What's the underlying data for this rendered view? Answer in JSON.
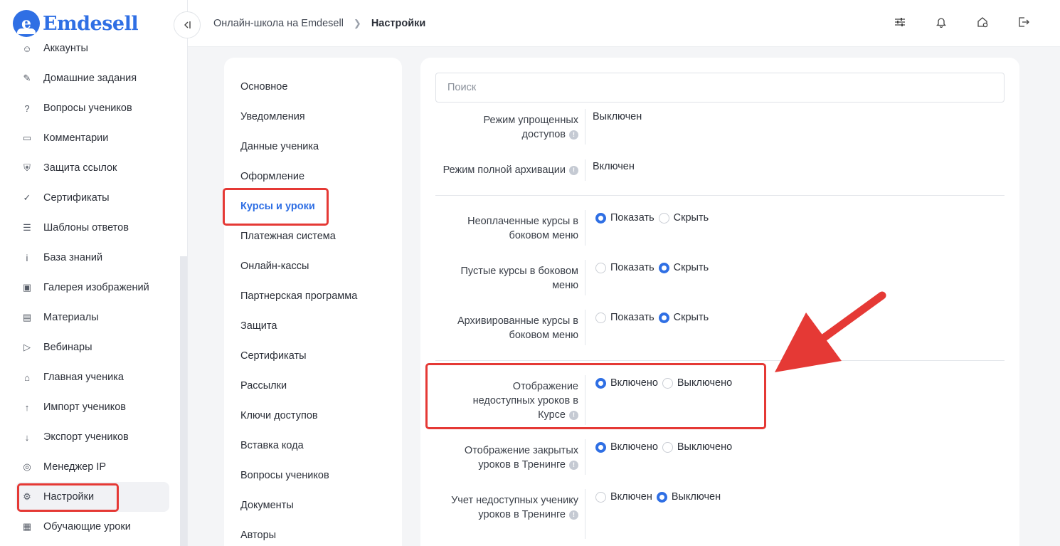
{
  "app": {
    "logo_letter": "e",
    "logo_text": "Emdesell",
    "brand_color": "#2f6fe4",
    "annotation_color": "#e53935"
  },
  "sidebar": {
    "items": [
      {
        "label": "Аккаунты",
        "icon": "users-icon"
      },
      {
        "label": "Домашние задания",
        "icon": "pencil-icon"
      },
      {
        "label": "Вопросы учеников",
        "icon": "question-circle-icon"
      },
      {
        "label": "Комментарии",
        "icon": "comment-icon"
      },
      {
        "label": "Защита ссылок",
        "icon": "shield-icon"
      },
      {
        "label": "Сертификаты",
        "icon": "badge-icon"
      },
      {
        "label": "Шаблоны ответов",
        "icon": "list-icon"
      },
      {
        "label": "База знаний",
        "icon": "info-circle-icon"
      },
      {
        "label": "Галерея изображений",
        "icon": "image-icon"
      },
      {
        "label": "Материалы",
        "icon": "briefcase-icon"
      },
      {
        "label": "Вебинары",
        "icon": "play-icon"
      },
      {
        "label": "Главная ученика",
        "icon": "home-icon"
      },
      {
        "label": "Импорт учеников",
        "icon": "upload-icon"
      },
      {
        "label": "Экспорт учеников",
        "icon": "download-icon"
      },
      {
        "label": "Менеджер IP",
        "icon": "target-icon"
      },
      {
        "label": "Настройки",
        "icon": "gear-icon",
        "active": true
      },
      {
        "label": "Обучающие уроки",
        "icon": "film-icon"
      }
    ]
  },
  "header": {
    "breadcrumb": [
      "Онлайн-школа на Emdesell",
      "Настройки"
    ],
    "icons": [
      "sliders-icon",
      "bell-icon",
      "home-settings-icon",
      "logout-icon"
    ]
  },
  "settings_menu": {
    "items": [
      "Основное",
      "Уведомления",
      "Данные ученика",
      "Оформление",
      "Курсы и уроки",
      "Платежная система",
      "Онлайн-кассы",
      "Партнерская программа",
      "Защита",
      "Сертификаты",
      "Рассылки",
      "Ключи доступов",
      "Вставка кода",
      "Вопросы учеников",
      "Документы",
      "Авторы"
    ],
    "active_index": 4
  },
  "content": {
    "search_placeholder": "Поиск",
    "static_rows": [
      {
        "label": "Режим упрощенных доступов",
        "value": "Выключен"
      },
      {
        "label": "Режим полной архивации",
        "value": "Включен"
      }
    ],
    "radio_rows": [
      {
        "label": "Неоплаченные курсы в боковом меню",
        "info": false,
        "options": [
          "Показать",
          "Скрыть"
        ],
        "selected": 0
      },
      {
        "label": "Пустые курсы в боковом меню",
        "info": false,
        "options": [
          "Показать",
          "Скрыть"
        ],
        "selected": 1
      },
      {
        "label": "Архивированные курсы в боковом меню",
        "info": false,
        "options": [
          "Показать",
          "Скрыть"
        ],
        "selected": 1
      },
      {
        "label": "Отображение недоступных уроков в Курсе",
        "info": true,
        "options": [
          "Включено",
          "Выключено"
        ],
        "selected": 0
      },
      {
        "label": "Отображение закрытых уроков в Тренинге",
        "info": true,
        "options": [
          "Включено",
          "Выключено"
        ],
        "selected": 0
      },
      {
        "label": "Учет недоступных ученику уроков в Тренинге",
        "info": true,
        "options": [
          "Включен",
          "Выключен"
        ],
        "selected": 1
      }
    ]
  }
}
